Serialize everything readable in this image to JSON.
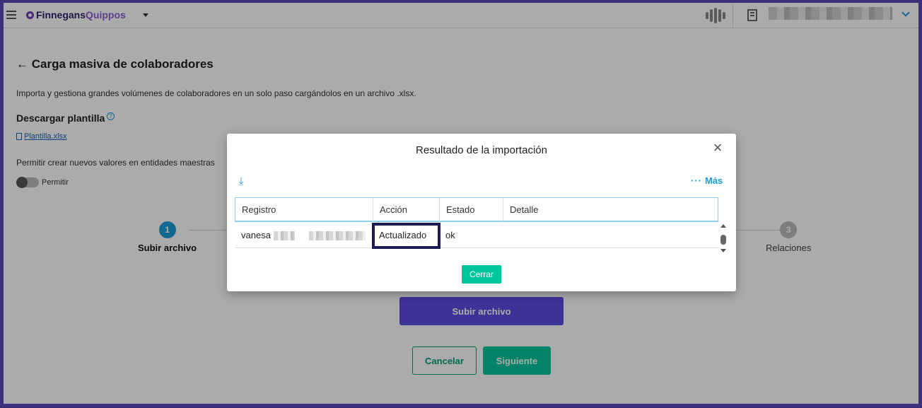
{
  "app": {
    "brand_a": "Finnegans",
    "brand_b": "Quippos"
  },
  "page": {
    "title": "Carga masiva de colaboradores",
    "description": "Importa y gestiona grandes volúmenes de colaboradores en un solo paso cargándolos en un archivo .xlsx.",
    "template_title": "Descargar plantilla",
    "template_file": "Plantilla.xlsx",
    "permit_text": "Permitir crear nuevos valores en entidades maestras",
    "toggle_label": "Permitir",
    "toggle_on": false
  },
  "steps": [
    {
      "number": "1",
      "label": "Subir archivo",
      "active": true
    },
    {
      "number": "3",
      "label": "Relaciones",
      "active": false
    }
  ],
  "buttons": {
    "upload": "Subir archivo",
    "cancel": "Cancelar",
    "next": "Siguiente"
  },
  "modal": {
    "title": "Resultado de la importación",
    "more_label": "Más",
    "close_button": "Cerrar",
    "columns": [
      "Registro",
      "Acción",
      "Estado",
      "Detalle"
    ],
    "rows": [
      {
        "registro": "vanesa",
        "accion": "Actualizado",
        "estado": "ok",
        "detalle": ""
      }
    ]
  },
  "colors": {
    "accent": "#1a9bd7",
    "primary": "#5b4be0",
    "success": "#00c49a",
    "highlight_border": "#1e1a52"
  },
  "icons": {
    "menu": "hamburger-icon",
    "back": "arrow-left-icon",
    "help": "help-circle-icon",
    "file": "file-icon",
    "download": "download-icon",
    "close": "close-icon",
    "more": "more-dots-icon",
    "company": "building-icon"
  }
}
